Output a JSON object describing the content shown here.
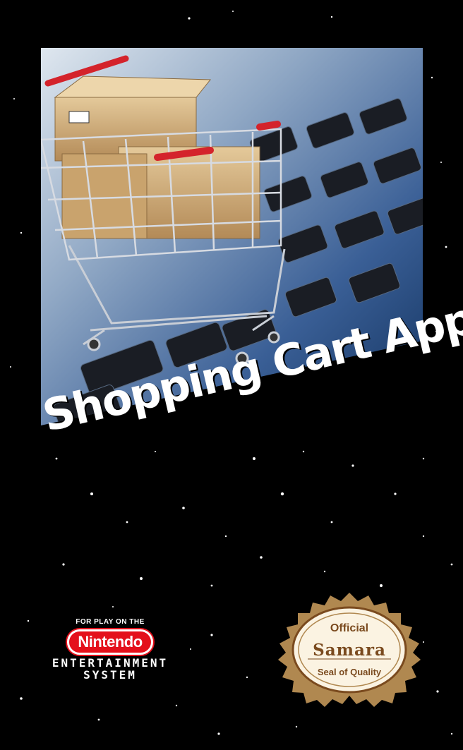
{
  "title": "Shopping Cart App",
  "badge": {
    "top_text": "FOR PLAY ON THE",
    "brand": "Nintendo",
    "line1": "ENTERTAINMENT",
    "line2": "SYSTEM"
  },
  "seal": {
    "line1": "Official",
    "line2": "Samara",
    "line3": "Seal of Quality"
  },
  "colors": {
    "background": "#000000",
    "nintendo_red": "#e4101b",
    "seal_gold": "#b08850",
    "seal_text": "#7a4a1e"
  }
}
